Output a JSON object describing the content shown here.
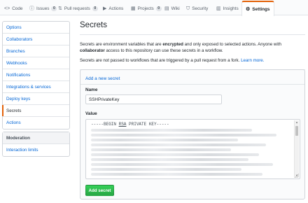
{
  "tabs": [
    {
      "label": "Code",
      "icon": "code-icon",
      "glyph": "<>",
      "count": null
    },
    {
      "label": "Issues",
      "icon": "issue-icon",
      "glyph": "ⓘ",
      "count": "0"
    },
    {
      "label": "Pull requests",
      "icon": "pull-request-icon",
      "glyph": "⇅",
      "count": "0"
    },
    {
      "label": "Actions",
      "icon": "play-icon",
      "glyph": "▶",
      "count": null
    },
    {
      "label": "Projects",
      "icon": "project-icon",
      "glyph": "▦",
      "count": "0"
    },
    {
      "label": "Wiki",
      "icon": "book-icon",
      "glyph": "▤",
      "count": null
    },
    {
      "label": "Security",
      "icon": "shield-icon",
      "glyph": "⛉",
      "count": null
    },
    {
      "label": "Insights",
      "icon": "graph-icon",
      "glyph": "▥",
      "count": null
    },
    {
      "label": "Settings",
      "icon": "gear-icon",
      "glyph": "⚙",
      "count": null
    }
  ],
  "sidebar": {
    "items": [
      {
        "label": "Options"
      },
      {
        "label": "Collaborators"
      },
      {
        "label": "Branches"
      },
      {
        "label": "Webhooks"
      },
      {
        "label": "Notifications"
      },
      {
        "label": "Integrations & services"
      },
      {
        "label": "Deploy keys"
      },
      {
        "label": "Secrets"
      },
      {
        "label": "Actions"
      }
    ],
    "moderation_heading": "Moderation",
    "moderation_items": [
      {
        "label": "Interaction limits"
      }
    ]
  },
  "main": {
    "title": "Secrets",
    "desc_part1": "Secrets are environment variables that are ",
    "desc_bold1": "encrypted",
    "desc_part2": " and only exposed to selected actions. Anyone with ",
    "desc_bold2": "collaborator",
    "desc_part3": " access to this repository can use these secrets in a workflow.",
    "desc2_text": "Secrets are not passed to workflows that are triggered by a pull request from a fork. ",
    "learn_more": "Learn more."
  },
  "form": {
    "add_link": "Add a new secret",
    "name_label": "Name",
    "name_value": "SSHPrivateKey",
    "value_label": "Value",
    "value_first_line_a": "-----BEGIN ",
    "value_first_line_b": "RSA",
    "value_first_line_c": " PRIVATE KEY-----",
    "submit_label": "Add secret"
  },
  "colors": {
    "accent": "#e36209",
    "link": "#0366d6",
    "button": "#28a745"
  }
}
